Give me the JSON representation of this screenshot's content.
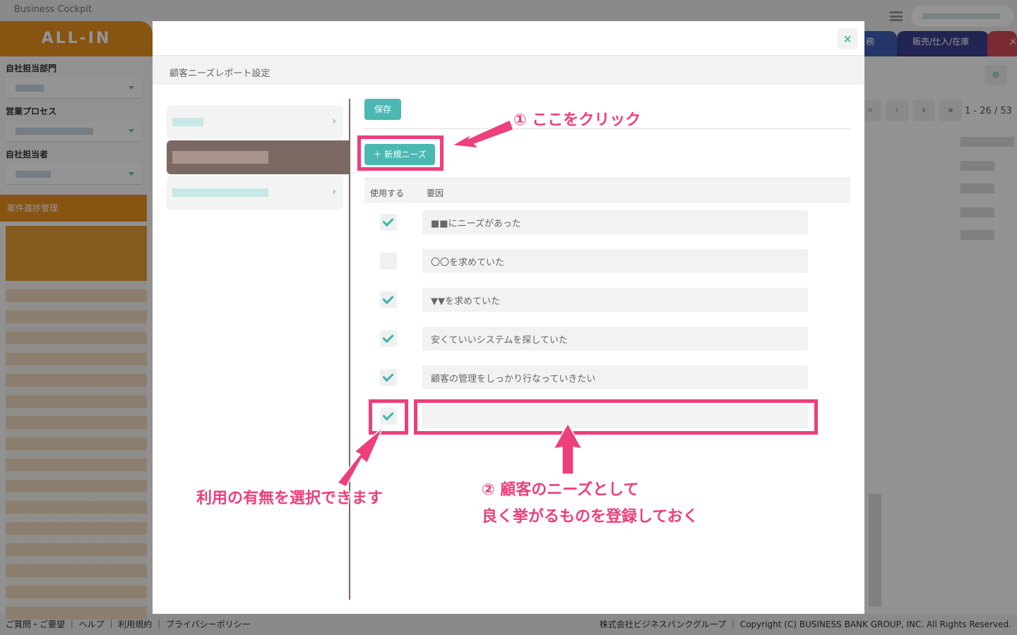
{
  "app": {
    "title": "Business Cockpit",
    "logo": "ALL-IN"
  },
  "sidebar": {
    "labels": [
      "自社担当部門",
      "営業プロセス",
      "自社担当者"
    ],
    "section": "案件進捗管理"
  },
  "top_tabs": [
    {
      "label": "務",
      "color": "#3f5fb3"
    },
    {
      "label": "販売/仕入/在庫",
      "color": "#3b3f8f"
    },
    {
      "label": "メ",
      "color": "#d04a55"
    }
  ],
  "pager": {
    "first": "«",
    "prev": "‹",
    "next": "›",
    "last": "»",
    "range": "1 - 26 / 53"
  },
  "modal": {
    "close": "×",
    "title": "顧客ニーズレポート設定",
    "save_label": "保存",
    "new_label": "＋ 新規ニーズ",
    "col_use": "使用する",
    "col_factor": "要因",
    "rows": [
      {
        "checked": true,
        "value": "■■にニーズがあった"
      },
      {
        "checked": false,
        "value": "〇〇を求めていた"
      },
      {
        "checked": true,
        "value": "▼▼を求めていた"
      },
      {
        "checked": true,
        "value": "安くていいシステムを探していた"
      },
      {
        "checked": true,
        "value": "顧客の管理をしっかり行なっていきたい"
      },
      {
        "checked": true,
        "value": ""
      }
    ]
  },
  "annotations": {
    "a1": "① ここをクリック",
    "a2_line1": "② 顧客のニーズとして",
    "a2_line2": "良く挙がるものを登録しておく",
    "a3": "利用の有無を選択できます",
    "color": "#ee3e7c"
  },
  "footer": {
    "left": "ご質問・ご要望 ｜ ヘルプ ｜ 利用規約 ｜ プライバシーポリシー",
    "right": "株式会社ビジネスバンクグループ ｜ Copyright (C) BUSINESS BANK GROUP, INC. All Rights Reserved."
  }
}
